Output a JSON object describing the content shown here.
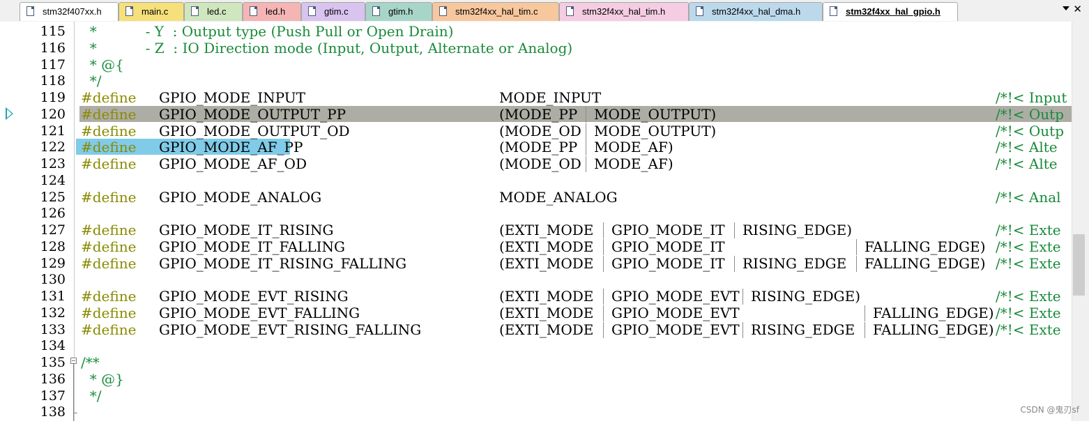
{
  "tabs": [
    {
      "label": "stm32f407xx.h",
      "color": "#ffffff",
      "active": false
    },
    {
      "label": "main.c",
      "color": "#f6e07a",
      "active": false
    },
    {
      "label": "led.c",
      "color": "#cfe6bf",
      "active": false
    },
    {
      "label": "led.h",
      "color": "#f5b5b5",
      "active": false
    },
    {
      "label": "gtim.c",
      "color": "#d8c4ef",
      "active": false
    },
    {
      "label": "gtim.h",
      "color": "#a7d6c8",
      "active": false
    },
    {
      "label": "stm32f4xx_hal_tim.c",
      "color": "#f7c79e",
      "active": false
    },
    {
      "label": "stm32f4xx_hal_tim.h",
      "color": "#f5cde2",
      "active": false
    },
    {
      "label": "stm32f4xx_hal_dma.h",
      "color": "#bcd9ec",
      "active": false
    },
    {
      "label": "stm32f4xx_hal_gpio.h",
      "color": "#ffffff",
      "active": true
    }
  ],
  "tab_menu_icon": "triangle-down",
  "tab_close_icon": "x",
  "close_glyph": "✕",
  "editor": {
    "current_line": 120,
    "selected_text": "#define  GPIO_MODE_AF_PP",
    "line_numbers": [
      "115",
      "116",
      "117",
      "118",
      "119",
      "120",
      "121",
      "122",
      "123",
      "124",
      "125",
      "126",
      "127",
      "128",
      "129",
      "130",
      "131",
      "132",
      "133",
      "134",
      "135",
      "136",
      "137",
      "138"
    ],
    "lines": [
      {
        "comment": "  *           - Y  : Output type (Push Pull or Open Drain)"
      },
      {
        "comment": "  *           - Z  : IO Direction mode (Input, Output, Alternate or Analog)"
      },
      {
        "comment": "  * @{"
      },
      {
        "comment": "  */"
      },
      {
        "define": "#define",
        "name": "GPIO_MODE_INPUT",
        "value": [
          "MODE_INPUT"
        ],
        "trail": "/*!< Input"
      },
      {
        "define": "#define",
        "name": "GPIO_MODE_OUTPUT_PP",
        "value": [
          "(MODE_PP",
          "MODE_OUTPUT)"
        ],
        "trail": "/*!< Outp"
      },
      {
        "define": "#define",
        "name": "GPIO_MODE_OUTPUT_OD",
        "value": [
          "(MODE_OD",
          "MODE_OUTPUT)"
        ],
        "trail": "/*!< Outp"
      },
      {
        "define": "#define",
        "name": "GPIO_MODE_AF_PP",
        "value": [
          "(MODE_PP",
          "MODE_AF)"
        ],
        "trail": "/*!< Alte"
      },
      {
        "define": "#define",
        "name": "GPIO_MODE_AF_OD",
        "value": [
          "(MODE_OD",
          "MODE_AF)"
        ],
        "trail": "/*!< Alte"
      },
      {},
      {
        "define": "#define",
        "name": "GPIO_MODE_ANALOG",
        "value": [
          "MODE_ANALOG"
        ],
        "trail": "/*!< Anal"
      },
      {},
      {
        "define": "#define",
        "name": "GPIO_MODE_IT_RISING",
        "value": [
          "(EXTI_MODE",
          "GPIO_MODE_IT",
          "RISING_EDGE)"
        ],
        "trail": "/*!< Exte"
      },
      {
        "define": "#define",
        "name": "GPIO_MODE_IT_FALLING",
        "value": [
          "(EXTI_MODE",
          "GPIO_MODE_IT",
          "FALLING_EDGE)"
        ],
        "trail": "/*!< Exte"
      },
      {
        "define": "#define",
        "name": "GPIO_MODE_IT_RISING_FALLING",
        "value": [
          "(EXTI_MODE",
          "GPIO_MODE_IT",
          "RISING_EDGE",
          "FALLING_EDGE)"
        ],
        "trail": "/*!< Exte"
      },
      {},
      {
        "define": "#define",
        "name": "GPIO_MODE_EVT_RISING",
        "value": [
          "(EXTI_MODE",
          "GPIO_MODE_EVT",
          "RISING_EDGE)"
        ],
        "trail": "/*!< Exte"
      },
      {
        "define": "#define",
        "name": "GPIO_MODE_EVT_FALLING",
        "value": [
          "(EXTI_MODE",
          "GPIO_MODE_EVT",
          "FALLING_EDGE)"
        ],
        "trail": "/*!< Exte"
      },
      {
        "define": "#define",
        "name": "GPIO_MODE_EVT_RISING_FALLING",
        "value": [
          "(EXTI_MODE",
          "GPIO_MODE_EVT",
          "RISING_EDGE",
          "FALLING_EDGE)"
        ],
        "trail": "/*!< Exte"
      },
      {},
      {
        "comment": "/**"
      },
      {
        "comment": "  * @}"
      },
      {
        "comment": "  */"
      },
      {}
    ]
  },
  "colors": {
    "comment": "#198a3a",
    "preprocessor": "#8a8a00",
    "current_line": "#adada5",
    "selection": "#7fcbe8",
    "marker": "#20a0b0"
  },
  "watermark": "CSDN @鬼刃sf"
}
